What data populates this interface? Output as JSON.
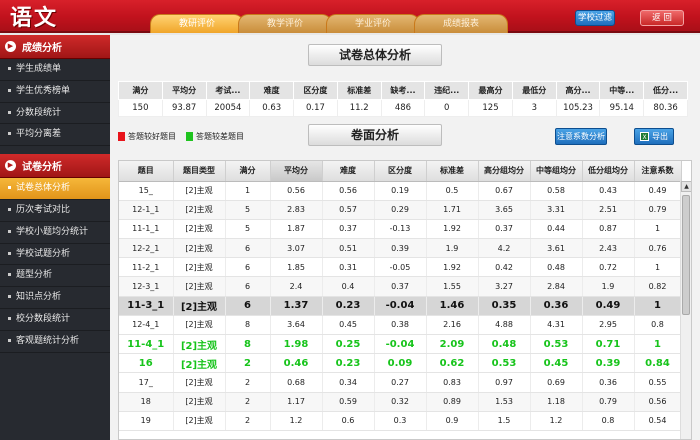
{
  "app": {
    "logo": "语文"
  },
  "tabs": [
    {
      "label": "教研评价",
      "active": true
    },
    {
      "label": "教学评价",
      "active": false
    },
    {
      "label": "学业评价",
      "active": false
    },
    {
      "label": "成绩报表",
      "active": false
    }
  ],
  "header": {
    "filter_label": "学校过滤",
    "back_label": "返 回"
  },
  "sidebar": {
    "section1": {
      "title": "成绩分析",
      "icon": "chevron-right-icon"
    },
    "section1_items": [
      "学生成绩单",
      "学生优秀榜单",
      "分数段统计",
      "平均分离差"
    ],
    "section2": {
      "title": "试卷分析",
      "icon": "chevron-right-icon"
    },
    "section2_items": [
      "试卷总体分析",
      "历次考试对比",
      "学校小题均分统计",
      "学校试题分析",
      "题型分析",
      "知识点分析",
      "校分数段统计",
      "客观题统计分析"
    ],
    "active_item": "试卷总体分析"
  },
  "summary": {
    "title": "试卷总体分析",
    "headers": [
      "满分",
      "平均分",
      "考试...",
      "难度",
      "区分度",
      "标准差",
      "缺考...",
      "违纪...",
      "最高分",
      "最低分",
      "高分...",
      "中等...",
      "低分..."
    ],
    "values": [
      "150",
      "93.87",
      "20054",
      "0.63",
      "0.17",
      "11.2",
      "486",
      "0",
      "125",
      "3",
      "105.23",
      "95.14",
      "80.36"
    ]
  },
  "paper": {
    "title": "卷面分析",
    "legend": [
      {
        "label": "答题较好题目",
        "color": "#e8141b"
      },
      {
        "label": "答题较差题目",
        "color": "#1fc41f"
      }
    ],
    "coef_button": "注意系数分析",
    "export_button": "导出",
    "headers": [
      "题目",
      "题目类型",
      "满分",
      "平均分",
      "难度",
      "区分度",
      "标准差",
      "高分组均分",
      "中等组均分",
      "低分组均分",
      "注意系数"
    ],
    "rows": [
      {
        "cells": [
          "15_",
          "[2]主观",
          "1",
          "0.56",
          "0.56",
          "0.19",
          "0.5",
          "0.67",
          "0.58",
          "0.43",
          "0.49"
        ],
        "style": ""
      },
      {
        "cells": [
          "12-1_1",
          "[2]主观",
          "5",
          "2.83",
          "0.57",
          "0.29",
          "1.71",
          "3.65",
          "3.31",
          "2.51",
          "0.79"
        ],
        "style": "alt"
      },
      {
        "cells": [
          "11-1_1",
          "[2]主观",
          "5",
          "1.87",
          "0.37",
          "-0.13",
          "1.92",
          "0.37",
          "0.44",
          "0.87",
          "1"
        ],
        "style": ""
      },
      {
        "cells": [
          "12-2_1",
          "[2]主观",
          "6",
          "3.07",
          "0.51",
          "0.39",
          "1.9",
          "4.2",
          "3.61",
          "2.43",
          "0.76"
        ],
        "style": "alt"
      },
      {
        "cells": [
          "11-2_1",
          "[2]主观",
          "6",
          "1.85",
          "0.31",
          "-0.05",
          "1.92",
          "0.42",
          "0.48",
          "0.72",
          "1"
        ],
        "style": ""
      },
      {
        "cells": [
          "12-3_1",
          "[2]主观",
          "6",
          "2.4",
          "0.4",
          "0.37",
          "1.55",
          "3.27",
          "2.84",
          "1.9",
          "0.82"
        ],
        "style": "alt"
      },
      {
        "cells": [
          "11-3_1",
          "[2]主观",
          "6",
          "1.37",
          "0.23",
          "-0.04",
          "1.46",
          "0.35",
          "0.36",
          "0.49",
          "1"
        ],
        "style": "hl-gray"
      },
      {
        "cells": [
          "12-4_1",
          "[2]主观",
          "8",
          "3.64",
          "0.45",
          "0.38",
          "2.16",
          "4.88",
          "4.31",
          "2.95",
          "0.8"
        ],
        "style": ""
      },
      {
        "cells": [
          "11-4_1",
          "[2]主观",
          "8",
          "1.98",
          "0.25",
          "-0.04",
          "2.09",
          "0.48",
          "0.53",
          "0.71",
          "1"
        ],
        "style": "hl-green"
      },
      {
        "cells": [
          "16",
          "[2]主观",
          "2",
          "0.46",
          "0.23",
          "0.09",
          "0.62",
          "0.53",
          "0.45",
          "0.39",
          "0.84"
        ],
        "style": "hl-green"
      },
      {
        "cells": [
          "17_",
          "[2]主观",
          "2",
          "0.68",
          "0.34",
          "0.27",
          "0.83",
          "0.97",
          "0.69",
          "0.36",
          "0.55"
        ],
        "style": ""
      },
      {
        "cells": [
          "18",
          "[2]主观",
          "2",
          "1.17",
          "0.59",
          "0.32",
          "0.89",
          "1.53",
          "1.18",
          "0.79",
          "0.56"
        ],
        "style": "alt"
      },
      {
        "cells": [
          "19",
          "[2]主观",
          "2",
          "1.2",
          "0.6",
          "0.3",
          "0.9",
          "1.5",
          "1.2",
          "0.8",
          "0.54"
        ],
        "style": ""
      }
    ],
    "sorted_column": "平均分"
  }
}
